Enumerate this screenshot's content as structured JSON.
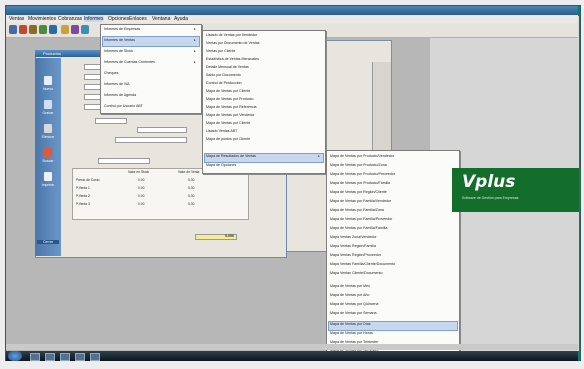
{
  "menubar": {
    "items": [
      "Ventas",
      "Movimientos",
      "Cobranzas",
      "Informes",
      "Opciones",
      "Enlaces",
      "Ventana",
      "Ayuda"
    ]
  },
  "informes_menu": {
    "items": [
      "Informes de Empresas",
      "Informes de Ventas",
      "Informes de Stock",
      "Informes de Cuentas Corrientes",
      "Cheques",
      "Informes de IVA",
      "Informes de Agenda",
      "Control por Usuario ABT"
    ]
  },
  "ventas_submenu": {
    "items": [
      "Listado de Ventas por Vendedor",
      "Ventas por Documento de Ventas",
      "Ventas por Cliente",
      "Estadística de Ventas Mensuales",
      "Detalle Mensual de Ventas",
      "Saldo por Documento",
      "Control de Producción",
      "Mapa de Ventas por Cliente",
      "Mapa de Ventas por Producto",
      "Mapa de Ventas por Referencia",
      "Mapa de Ventas por Vendedor",
      "Mapa de Ventas por Cliente",
      "Listado Ventas ABT",
      "Mapa de puntos por Cliente",
      "Mapa de Resultados de Ventas",
      "Mapa de Opciones"
    ]
  },
  "resultados_submenu": {
    "items": [
      "Mapa de Ventas por Producto/Vendedor",
      "Mapa de Ventas por Producto/Zona",
      "Mapa de Ventas por Producto/Proveedor",
      "Mapa de Ventas por Producto/Familia",
      "Mapa de Ventas por Región/Cliente",
      "Mapa de Ventas por Familia/Vendedor",
      "Mapa de Ventas por Familia/Zona",
      "Mapa de Ventas por Familia/Proveedor",
      "Mapa de Ventas por Familia/Familia",
      "Mapa Ventas Zona/Vendedor",
      "Mapa Ventas Región/Familia",
      "Mapa Ventas Región/Proveedor",
      "Mapa Ventas Familia/Cliente/Documento",
      "Mapa Ventas Cliente/Documento",
      "Mapa de Ventas por Mes",
      "Mapa de Ventas por Año",
      "Mapa de Ventas por Quincena",
      "Mapa de Ventas por Semana",
      "Mapa de Ventas por Días",
      "Mapa de Ventas por Horas",
      "Mapa de Ventas por Trimestre",
      "Mapa de Ventas por Semestre"
    ]
  },
  "window": {
    "title": "Productos",
    "sidebar": [
      "Nuevo",
      "Grabar",
      "Eliminar",
      "Buscar",
      "Imprimir",
      "Cerrar"
    ],
    "totals_headers": [
      "Valor en Stock",
      "Valor de Venta"
    ],
    "totals_rows": [
      {
        "label": "Precio de Costo",
        "a": "0.00",
        "b": "0.00"
      },
      {
        "label": "P.Venta 1",
        "a": "0.00",
        "b": "0.00"
      },
      {
        "label": "P.Venta 2",
        "a": "0.00",
        "b": "0.00"
      },
      {
        "label": "P.Venta 3",
        "a": "0.00",
        "b": "0.00"
      }
    ],
    "yellow_value": "0.000"
  },
  "banner": {
    "logo": "Vplus",
    "subtitle": "Software de Gestión para Empresas"
  },
  "colors": {
    "accent": "#2d6296",
    "banner": "#146e2b",
    "highlight": "#c7d8ee"
  }
}
